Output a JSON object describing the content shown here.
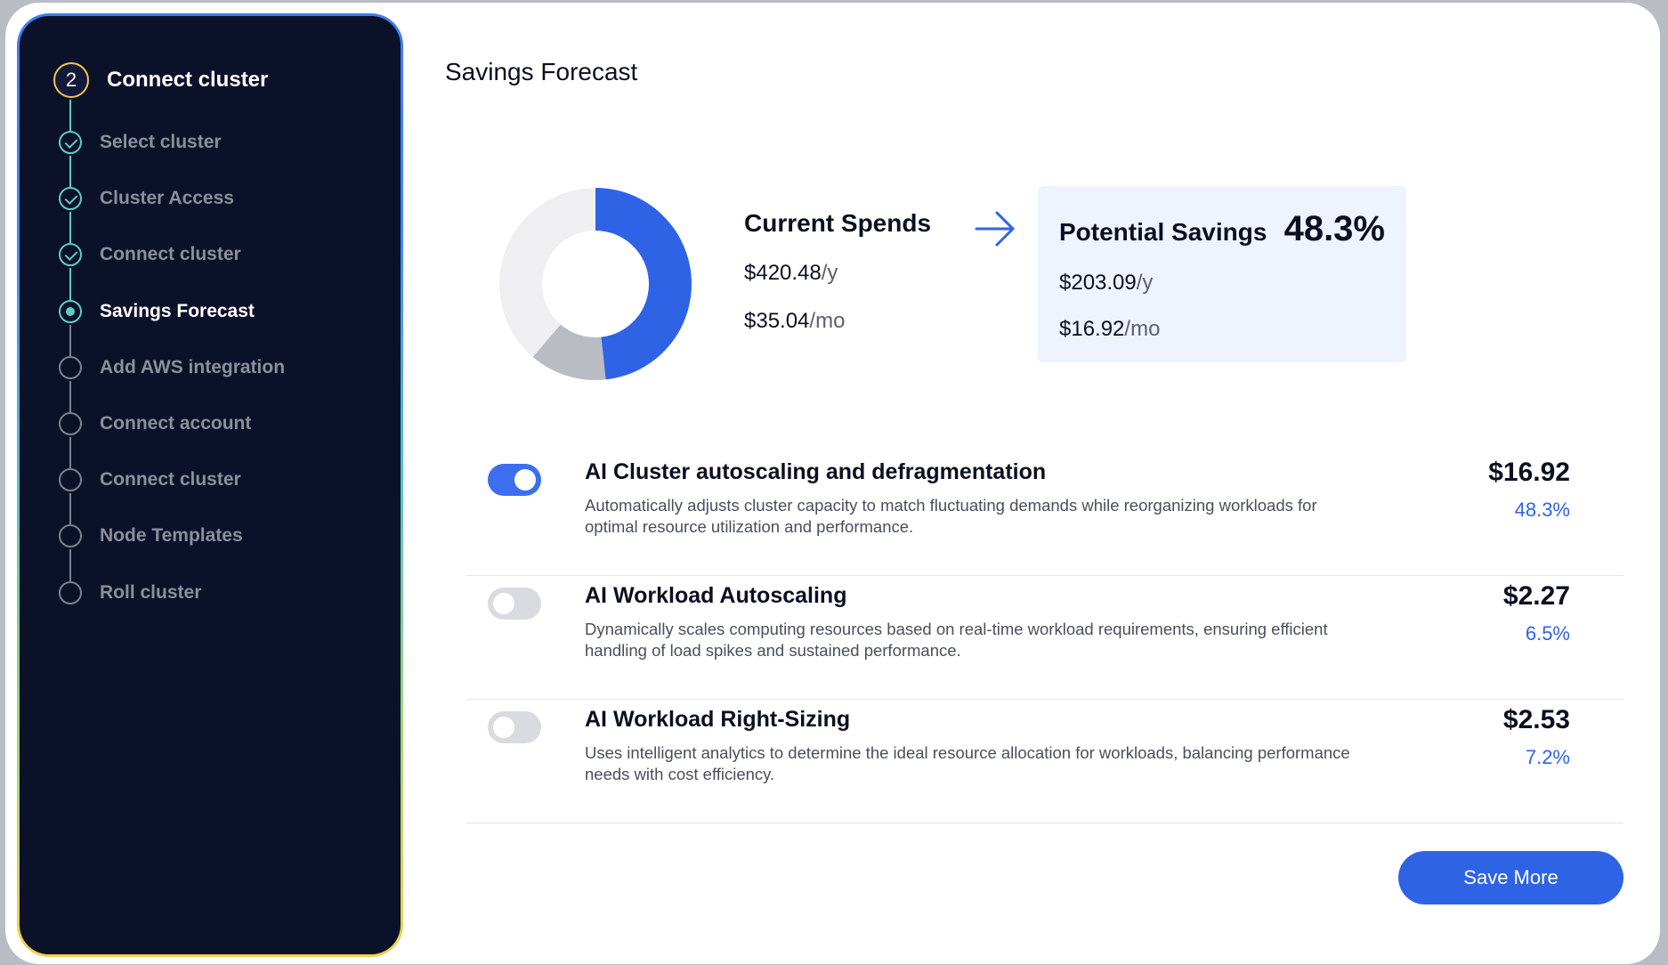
{
  "sidebar": {
    "header": {
      "step_number": "2",
      "title": "Connect cluster"
    },
    "items": [
      {
        "label": "Select cluster",
        "status": "done"
      },
      {
        "label": "Cluster Access",
        "status": "done"
      },
      {
        "label": "Connect cluster",
        "status": "done"
      },
      {
        "label": "Savings Forecast",
        "status": "current"
      },
      {
        "label": "Add AWS integration",
        "status": "pending"
      },
      {
        "label": "Connect account",
        "status": "pending"
      },
      {
        "label": "Connect cluster",
        "status": "pending"
      },
      {
        "label": "Node Templates",
        "status": "pending"
      },
      {
        "label": "Roll cluster",
        "status": "pending"
      }
    ]
  },
  "main": {
    "title": "Savings Forecast",
    "donut": {
      "type": "pie",
      "segments": [
        {
          "value": 48.3,
          "color": "#2f63e6"
        },
        {
          "value": 13,
          "color": "#b9bcc3"
        },
        {
          "value": 38.7,
          "color": "#efeff1"
        }
      ]
    },
    "current_spends": {
      "title": "Current Spends",
      "yearly": "$420.48",
      "yearly_unit": "/y",
      "monthly": "$35.04",
      "monthly_unit": "/mo"
    },
    "potential_savings": {
      "title": "Potential Savings",
      "percent": "48.3%",
      "yearly": "$203.09",
      "yearly_unit": "/y",
      "monthly": "$16.92",
      "monthly_unit": "/mo"
    },
    "features": [
      {
        "title": "AI Cluster autoscaling and defragmentation",
        "description": "Automatically adjusts cluster capacity to match fluctuating demands while reorganizing workloads for optimal resource utilization and performance.",
        "amount": "$16.92",
        "percent": "48.3%",
        "enabled": true
      },
      {
        "title": "AI Workload Autoscaling",
        "description": "Dynamically scales computing resources based on real-time workload requirements, ensuring efficient handling of load spikes and sustained performance.",
        "amount": "$2.27",
        "percent": "6.5%",
        "enabled": false
      },
      {
        "title": "AI Workload Right-Sizing",
        "description": "Uses intelligent analytics to determine the ideal resource allocation for workloads, balancing performance needs with cost efficiency.",
        "amount": "$2.53",
        "percent": "7.2%",
        "enabled": false
      }
    ],
    "save_button": "Save More"
  },
  "colors": {
    "accent": "#2f63e6",
    "sidebar_bg": "#0b1128",
    "done": "#5ccfc0"
  }
}
